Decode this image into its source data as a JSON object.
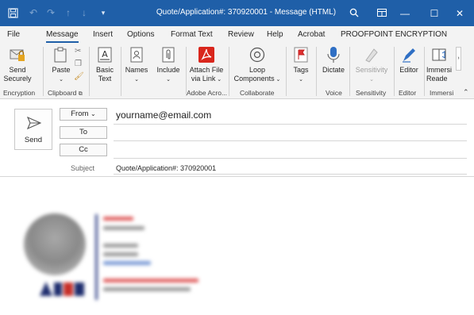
{
  "window": {
    "title": "Quote/Application#: 370920001  -  Message (HTML)"
  },
  "tabs": [
    "File",
    "Message",
    "Insert",
    "Options",
    "Format Text",
    "Review",
    "Help",
    "Acrobat",
    "PROOFPOINT ENCRYPTION"
  ],
  "active_tab": "Message",
  "ribbon": {
    "send_securely": "Send\nSecurely",
    "paste": "Paste",
    "basic_text": "Basic\nText",
    "names": "Names",
    "include": "Include",
    "attach_file": "Attach File\nvia Link",
    "loop": "Loop\nComponents",
    "tags": "Tags",
    "dictate": "Dictate",
    "sensitivity": "Sensitivity",
    "editor": "Editor",
    "immersive": "Immersi\nReade",
    "groups": {
      "encryption": "Encryption",
      "clipboard": "Clipboard",
      "adobe": "Adobe Acro...",
      "collaborate": "Collaborate",
      "voice": "Voice",
      "sensitivity": "Sensitivity",
      "editor": "Editor",
      "immersive": "Immersi"
    }
  },
  "compose": {
    "send_label": "Send",
    "from_label": "From",
    "from_value": "yourname@email.com",
    "to_label": "To",
    "cc_label": "Cc",
    "subject_label": "Subject",
    "subject_value": "Quote/Application#: 370920001"
  },
  "colors": {
    "titlebar": "#1f5fa8",
    "accent": "#1f5fa8",
    "ribbon_bg": "#f3f3f3",
    "adobe_red": "#d9261c"
  }
}
